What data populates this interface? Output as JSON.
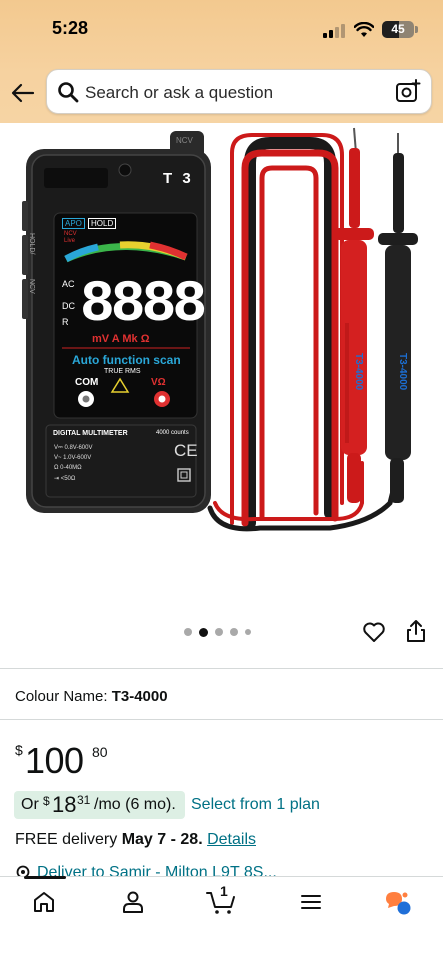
{
  "status_bar": {
    "time": "5:28",
    "battery": "45"
  },
  "search": {
    "placeholder": "Search or ask a question"
  },
  "product": {
    "image_alt": "T3 digital multimeter with test leads",
    "device_brand": "T 3",
    "device_readout": "8.8.8.8",
    "device_units": "mV A Mk Ω",
    "device_feature": "Auto function scan",
    "device_subfeature": "TRUE RMS",
    "device_label": "DIGITAL MULTIMETER",
    "device_counts": "4000 counts",
    "device_com": "COM",
    "device_vo": "VΩ",
    "device_apo": "APO",
    "device_hold": "HOLD",
    "device_ncv": "NCV",
    "device_ncv_live": "NCV Live",
    "device_ac": "AC",
    "device_dc": "DC",
    "device_r": "R",
    "device_cat": "CATⅢ 600V",
    "device_ce": "CE",
    "device_side_labels": [
      "HOLD/",
      "NCV"
    ],
    "device_specs": [
      "V⎓ 0.8V-600V",
      "V~ 1.0V-600V",
      "Ω  0-40MΩ",
      "⇥  <50Ω"
    ],
    "carousel": {
      "count": 5,
      "active_index": 1
    }
  },
  "colour": {
    "label": "Colour Name:",
    "value": "T3-4000"
  },
  "price": {
    "symbol": "$",
    "whole": "100",
    "fraction": "80"
  },
  "plan": {
    "prefix": "Or",
    "symbol": "$",
    "amount": "18",
    "cents": "31",
    "suffix": "/mo (6 mo).",
    "link": "Select from 1 plan"
  },
  "delivery": {
    "prefix": "FREE delivery",
    "date": "May 7 - 28.",
    "link": "Details"
  },
  "deliver_to": {
    "text": "Deliver to Samir - Milton L9T 8S..."
  },
  "bottom_nav": {
    "cart_count": "1"
  },
  "colors": {
    "accent_link": "#007185",
    "plan_badge": "#ddefe4",
    "header": "#f3c98f",
    "rufus": "#ff7f3f"
  }
}
